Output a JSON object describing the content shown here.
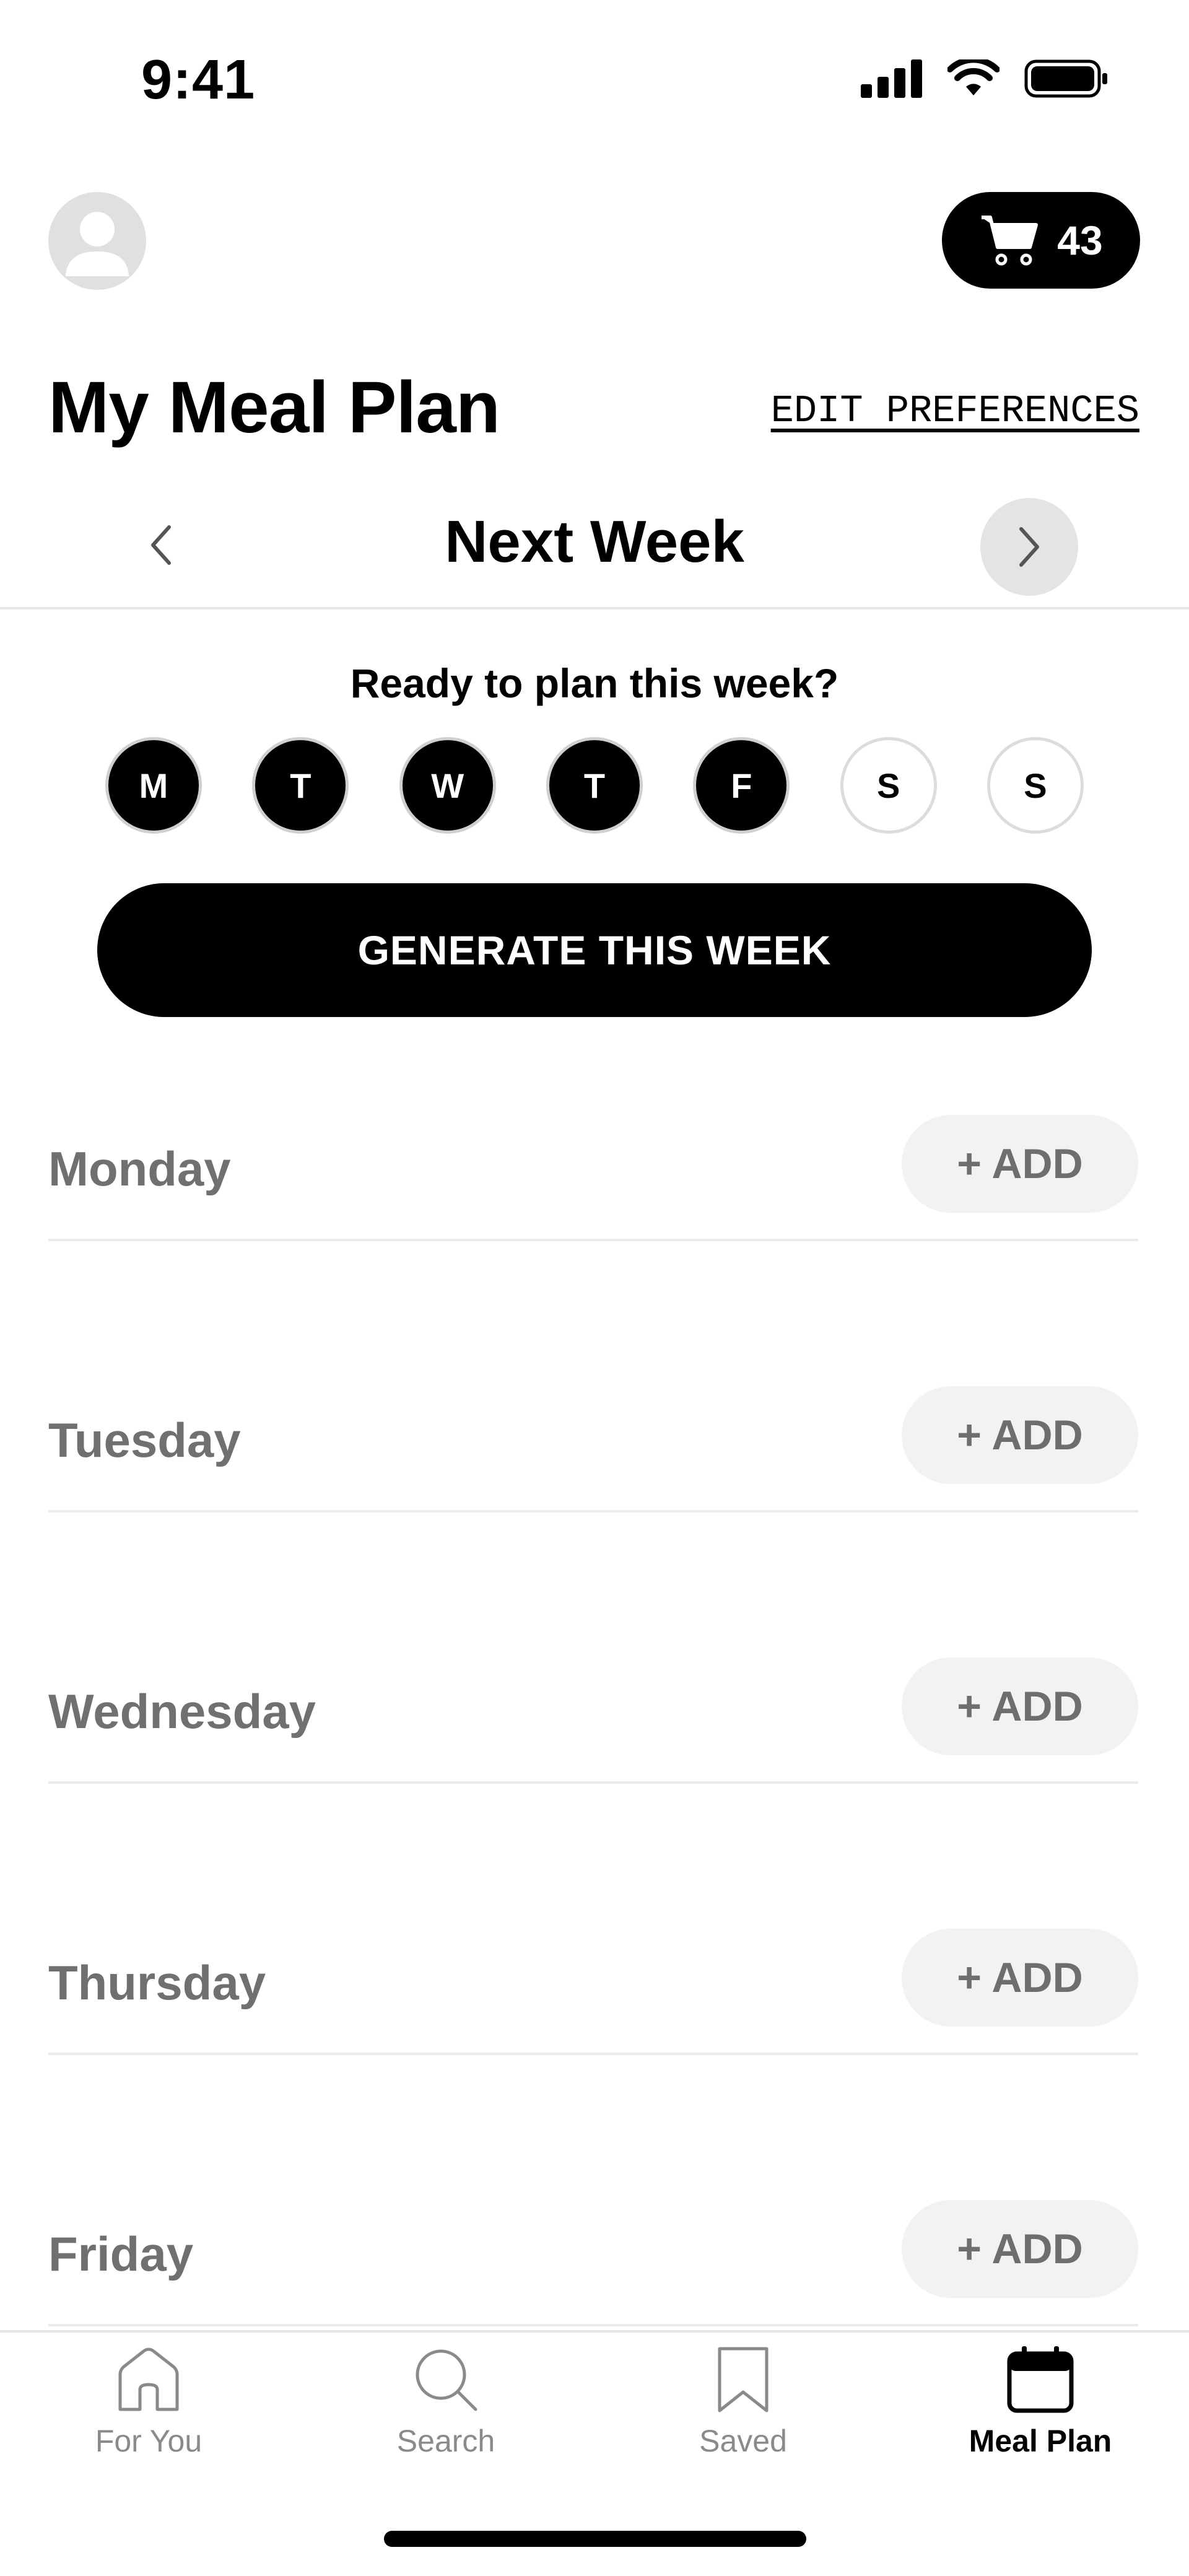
{
  "status_bar": {
    "time": "9:41"
  },
  "header": {
    "cart_count": "43",
    "title": "My Meal Plan",
    "edit_preferences": "EDIT PREFERENCES"
  },
  "week_nav": {
    "label": "Next Week"
  },
  "planner": {
    "prompt": "Ready to plan this week?",
    "days": [
      {
        "letter": "M",
        "selected": true
      },
      {
        "letter": "T",
        "selected": true
      },
      {
        "letter": "W",
        "selected": true
      },
      {
        "letter": "T",
        "selected": true
      },
      {
        "letter": "F",
        "selected": true
      },
      {
        "letter": "S",
        "selected": false
      },
      {
        "letter": "S",
        "selected": false
      }
    ],
    "generate_label": "GENERATE THIS WEEK"
  },
  "schedule": [
    {
      "day": "Monday",
      "add_label": "+ ADD"
    },
    {
      "day": "Tuesday",
      "add_label": "+ ADD"
    },
    {
      "day": "Wednesday",
      "add_label": "+ ADD"
    },
    {
      "day": "Thursday",
      "add_label": "+ ADD"
    },
    {
      "day": "Friday",
      "add_label": "+ ADD"
    }
  ],
  "tabs": [
    {
      "label": "For You",
      "icon": "home-icon",
      "active": false
    },
    {
      "label": "Search",
      "icon": "search-icon",
      "active": false
    },
    {
      "label": "Saved",
      "icon": "bookmark-icon",
      "active": false
    },
    {
      "label": "Meal Plan",
      "icon": "calendar-icon",
      "active": true
    }
  ]
}
